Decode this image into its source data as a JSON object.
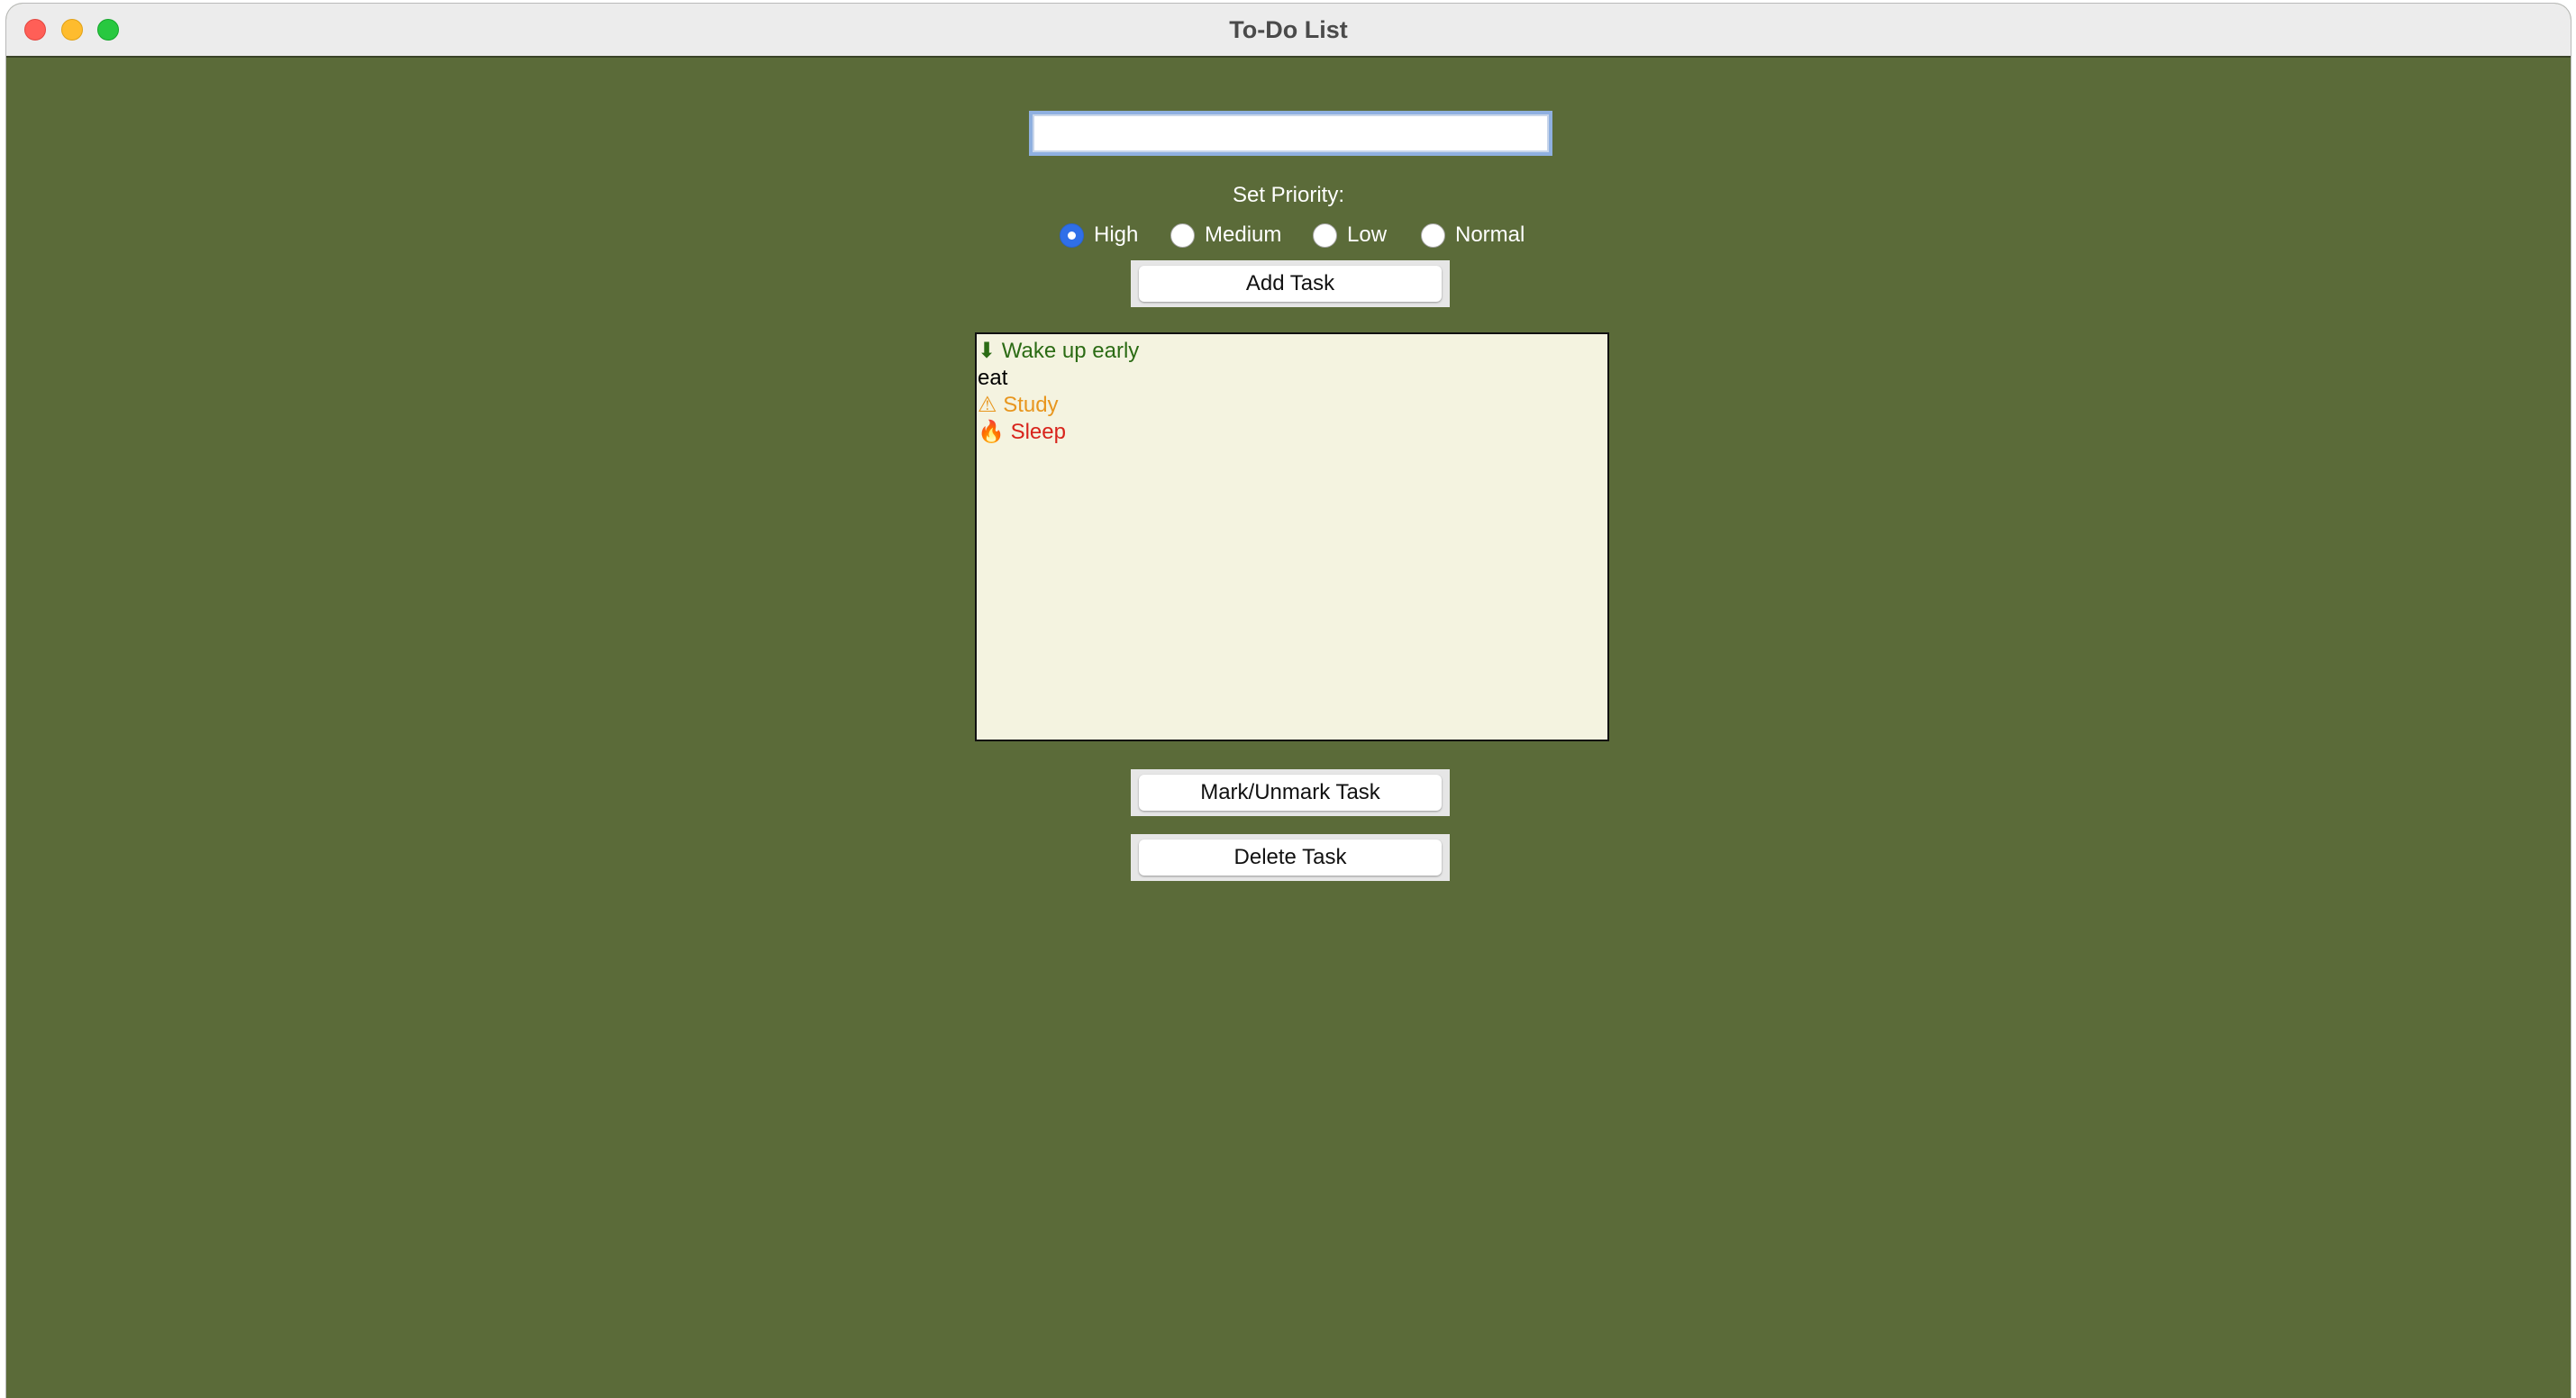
{
  "window": {
    "title": "To-Do List"
  },
  "task_input": {
    "value": "",
    "placeholder": ""
  },
  "priority": {
    "label": "Set Priority:",
    "options": [
      {
        "label": "High",
        "selected": true
      },
      {
        "label": "Medium",
        "selected": false
      },
      {
        "label": "Low",
        "selected": false
      },
      {
        "label": "Normal",
        "selected": false
      }
    ]
  },
  "buttons": {
    "add": "Add Task",
    "mark": "Mark/Unmark Task",
    "delete": "Delete Task"
  },
  "tasks": [
    {
      "icon": "⬇",
      "icon_name": "down-arrow-icon",
      "text": "Wake up early",
      "color": "#2b6b14"
    },
    {
      "icon": "",
      "icon_name": "",
      "text": "eat",
      "color": "#000000"
    },
    {
      "icon": "⚠",
      "icon_name": "warning-icon",
      "text": "Study",
      "color": "#e8961e"
    },
    {
      "icon": "🔥",
      "icon_name": "fire-icon",
      "text": "Sleep",
      "color": "#d8231b"
    }
  ],
  "colors": {
    "background": "#5b6b39",
    "listbox": "#f4f3e0",
    "radio_selected": "#2f6fe8"
  }
}
